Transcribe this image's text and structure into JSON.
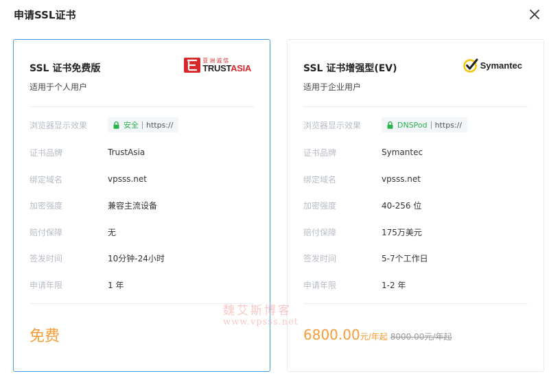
{
  "dialog": {
    "title": "申请SSL证书",
    "close_icon": "close-icon"
  },
  "labels": {
    "browser": "浏览器显示效果",
    "brand": "证书品牌",
    "domain": "绑定域名",
    "encryption": "加密强度",
    "warranty": "赔付保障",
    "issue_time": "签发时间",
    "years": "申请年限"
  },
  "cards": [
    {
      "name": "SSL 证书免费版",
      "desc": "适用于个人用户",
      "logo": {
        "cn": "亚洲诚信",
        "en_a": "TRUST",
        "en_b": "ASIA",
        "brand_color": "#d6282a"
      },
      "browser_secure_text": "安全",
      "browser_protocol": "https://",
      "brand": "TrustAsia",
      "domain": "vpsss.net",
      "encryption": "兼容主流设备",
      "warranty": "无",
      "issue_time": "10分钟-24小时",
      "years": "1 年",
      "price": "免费",
      "selected": true
    },
    {
      "name": "SSL 证书增强型(EV)",
      "desc": "适用于企业用户",
      "logo": {
        "name": "Symantec",
        "check_color": "#f5c400"
      },
      "browser_secure_text": "DNSPod",
      "browser_protocol": "https://",
      "brand": "Symantec",
      "domain": "vpsss.net",
      "encryption": "40-256 位",
      "warranty": "175万美元",
      "issue_time": "5-7个工作日",
      "years": "1-2 年",
      "price": "6800.00",
      "price_unit": "元/年起",
      "price_old": "8000.00元/年起",
      "selected": false
    }
  ],
  "watermark": {
    "line1": "魏艾斯博客",
    "line2": "www.vpsss.net"
  },
  "colors": {
    "accent_orange": "#f79b34",
    "selected_border": "#3d9be9",
    "secure_green": "#2bb24c",
    "label_gray": "#b7bcc5"
  }
}
